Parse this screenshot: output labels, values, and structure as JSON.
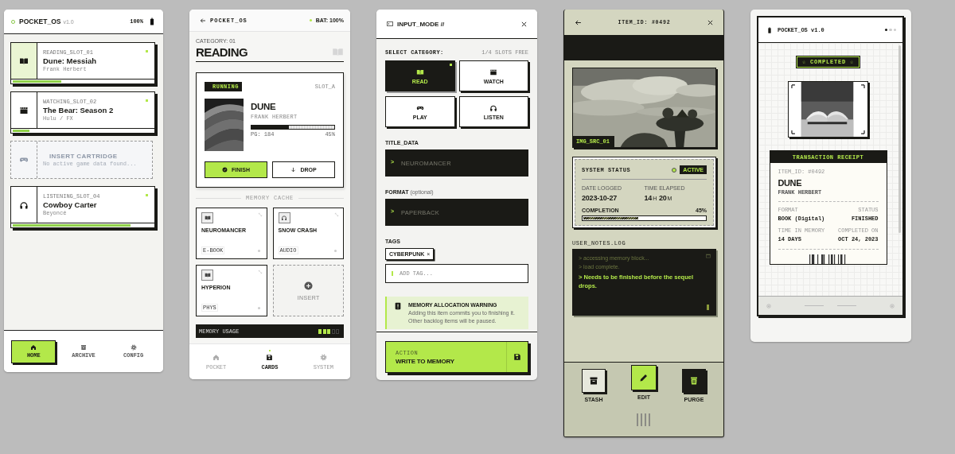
{
  "dashboard": {
    "header": {
      "title": "POCKET_OS",
      "version": "v1.0",
      "battery": "100%"
    },
    "slots": [
      {
        "kind": "read",
        "label": "READING_SLOT_01",
        "title": "Dune: Messiah",
        "subtitle": "Frank Herbert",
        "level": 0.34,
        "highlighted": true
      },
      {
        "kind": "watch",
        "label": "WATCHING_SLOT_02",
        "title": "The Bear: Season 2",
        "subtitle": "Hulu / FX",
        "level": 0.12,
        "highlighted": false
      },
      {
        "kind": "empty",
        "title": "INSERT CARTRIDGE",
        "subtitle": "No active game data found..."
      },
      {
        "kind": "listen",
        "label": "LISTENING_SLOT_04",
        "title": "Cowboy Carter",
        "subtitle": "Beyoncé",
        "level": 0.83,
        "highlighted": false
      }
    ],
    "nav": [
      {
        "kind": "home",
        "label": "HOME",
        "selected": true
      },
      {
        "kind": "archive",
        "label": "ARCHIVE",
        "selected": false
      },
      {
        "kind": "config",
        "label": "CONFIG",
        "selected": false
      }
    ]
  },
  "category_detail": {
    "header": {
      "title": "POCKET_OS",
      "battery": "BAT: 100%"
    },
    "category_label": "CATEGORY: 01",
    "title": "READING",
    "active": {
      "status": "RUNNING",
      "slot": "SLOT_A",
      "title": "DUNE",
      "author": "FRANK HERBERT",
      "level": 0.45,
      "page": "PG: 184",
      "percent": "45%",
      "actions": [
        {
          "kind": "finish",
          "label": "FINISH"
        },
        {
          "kind": "drop",
          "label": "DROP"
        }
      ]
    },
    "cache_title": "MEMORY CACHE",
    "cache": [
      {
        "kind": "read",
        "title": "NEUROMANCER",
        "format": "E-BOOK"
      },
      {
        "kind": "listen",
        "title": "SNOW CRASH",
        "format": "AUDIO"
      },
      {
        "kind": "read",
        "title": "HYPERION",
        "format": "PHYS"
      },
      {
        "kind": "empty",
        "title": "INSERT"
      }
    ],
    "memory": {
      "label": "MEMORY USAGE",
      "level": 0.6
    },
    "nav": [
      {
        "kind": "home",
        "label": "POCKET",
        "selected": false
      },
      {
        "kind": "cards",
        "label": "CARDS",
        "selected": true
      },
      {
        "kind": "system",
        "label": "SYSTEM",
        "selected": false
      }
    ]
  },
  "add_item": {
    "title": "INPUT_MODE //",
    "category_label": "SELECT CATEGORY:",
    "slots_free": "1/4 SLOTS FREE",
    "categories": [
      {
        "kind": "read",
        "label": "READ",
        "selected": true
      },
      {
        "kind": "watch",
        "label": "WATCH",
        "selected": false
      },
      {
        "kind": "play",
        "label": "PLAY",
        "selected": false
      },
      {
        "kind": "listen",
        "label": "LISTEN",
        "selected": false
      }
    ],
    "fields": [
      {
        "label": "TITLE_DATA",
        "prompt": ">",
        "placeholder": "NEUROMANCER"
      },
      {
        "label": "FORMAT",
        "hint": "(optional)",
        "prompt": ">",
        "placeholder": "PAPERBACK"
      }
    ],
    "tags_label": "TAGS",
    "tags": [
      {
        "label": "CYBERPUNK",
        "remove": "×"
      }
    ],
    "tag_input": {
      "placeholder": "ADD TAG..."
    },
    "warning": {
      "title": "MEMORY ALLOCATION WARNING",
      "text": "Adding this item commits you to finishing it. Other backlog items will be paused."
    },
    "action": {
      "caption": "ACTION",
      "label": "WRITE TO MEMORY"
    }
  },
  "item_detail": {
    "title": "ITEM_ID: #0492",
    "image_label": "IMG_SRC_01",
    "status": {
      "title": "SYSTEM STATUS",
      "state": "ACTIVE",
      "date_label": "DATE LOGGED",
      "date": "2023-10-27",
      "elapsed_label": "TIME ELAPSED",
      "elapsed": [
        {
          "value": "14",
          "unit": "H"
        },
        {
          "value": "20",
          "unit": "M"
        }
      ],
      "completion_label": "COMPLETION",
      "percent": "45%",
      "level": 0.45
    },
    "notes_title": "USER_NOTES.LOG",
    "notes": [
      {
        "text": "> accessing memory block...",
        "emphasis": false
      },
      {
        "text": "> load complete.",
        "emphasis": false
      },
      {
        "text": "> Needs to be finished before the sequel drops.",
        "emphasis": true
      }
    ],
    "actions": [
      {
        "kind": "stash",
        "label": "STASH",
        "selected": false
      },
      {
        "kind": "edit",
        "label": "EDIT",
        "selected": true
      },
      {
        "kind": "purge",
        "label": "PURGE",
        "selected": false
      }
    ]
  },
  "completion": {
    "header": {
      "title": "POCKET_OS v1.0"
    },
    "pager": [
      {
        "selected": true
      },
      {
        "selected": false
      },
      {
        "selected": false
      }
    ],
    "badge": "☆ COMPLETED ☆",
    "receipt": {
      "title": "TRANSACTION RECEIPT",
      "item_id": "ITEM_ID: #0492",
      "item_title": "DUNE",
      "author": "FRANK HERBERT",
      "fields": [
        {
          "label": "FORMAT",
          "value": "BOOK (Digital)"
        },
        {
          "label": "STATUS",
          "value": "FINISHED"
        },
        {
          "label": "TIME IN MEMORY",
          "value": "14 DAYS"
        },
        {
          "label": "COMPLETED ON",
          "value": "OCT 24, 2023"
        }
      ]
    }
  }
}
